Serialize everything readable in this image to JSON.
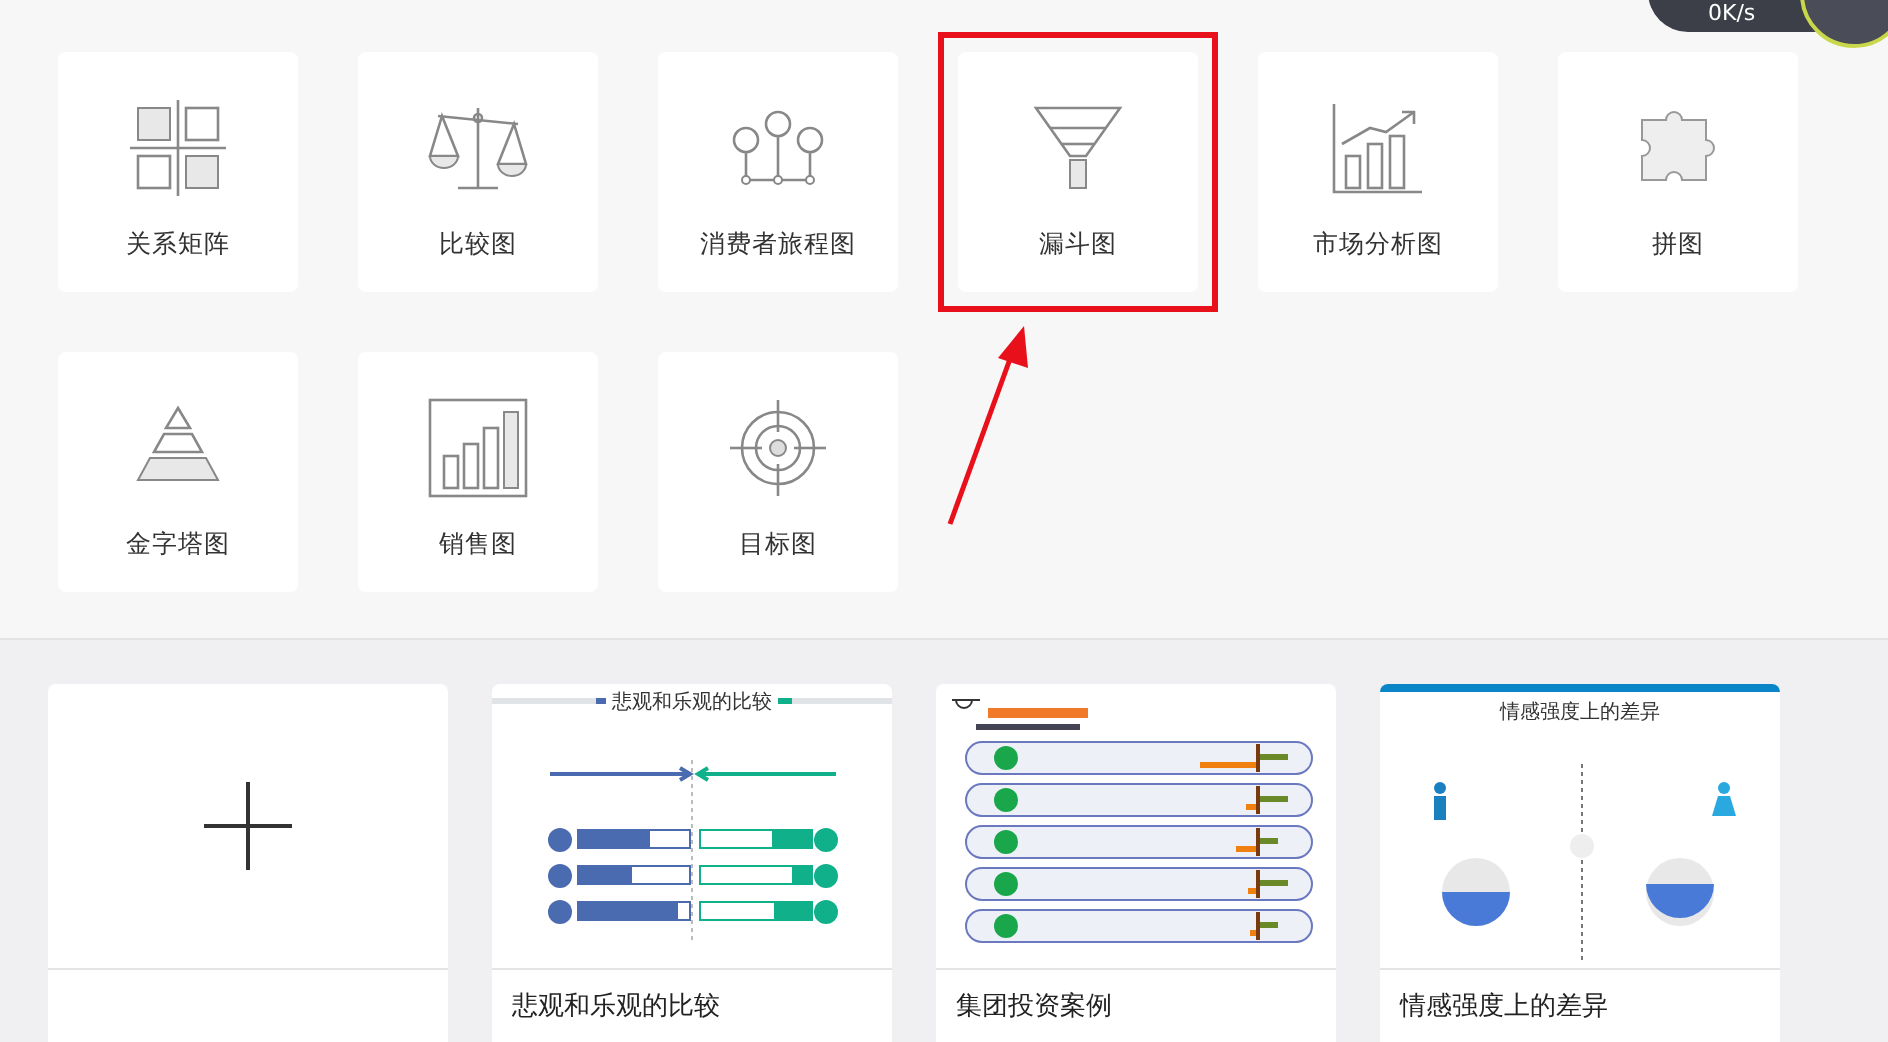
{
  "speed_widget": {
    "reading": "0K/s"
  },
  "chart_types": [
    {
      "label": "关系矩阵",
      "kind": "matrix",
      "highlighted": false
    },
    {
      "label": "比较图",
      "kind": "scale",
      "highlighted": false
    },
    {
      "label": "消费者旅程图",
      "kind": "journey",
      "highlighted": false
    },
    {
      "label": "漏斗图",
      "kind": "funnel",
      "highlighted": true
    },
    {
      "label": "市场分析图",
      "kind": "growth",
      "highlighted": false
    },
    {
      "label": "拼图",
      "kind": "puzzle",
      "highlighted": false
    },
    {
      "label": "金字塔图",
      "kind": "pyramid",
      "highlighted": false
    },
    {
      "label": "销售图",
      "kind": "bars",
      "highlighted": false
    },
    {
      "label": "目标图",
      "kind": "target",
      "highlighted": false
    }
  ],
  "templates": [
    {
      "kind": "blank"
    },
    {
      "kind": "comparison",
      "heading": "悲观和乐观的比较",
      "caption": "悲观和乐观的比较"
    },
    {
      "kind": "investment",
      "caption": "集团投资案例"
    },
    {
      "kind": "emotion",
      "heading": "情感强度上的差异",
      "caption": "情感强度上的差异"
    }
  ]
}
